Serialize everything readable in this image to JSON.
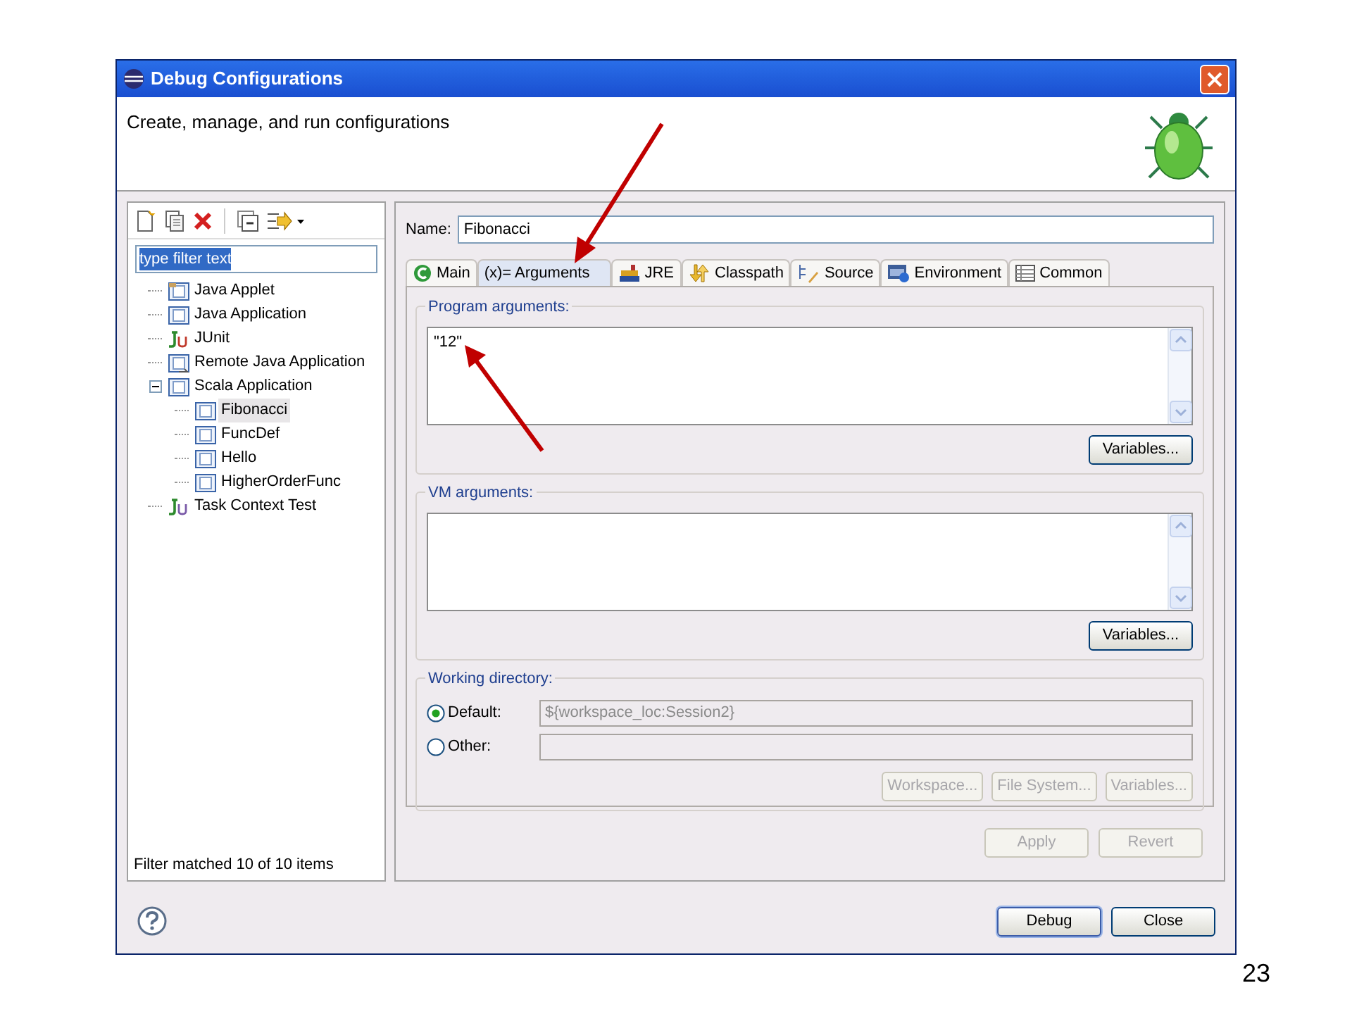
{
  "window": {
    "title": "Debug Configurations"
  },
  "header": {
    "text": "Create, manage, and run configurations"
  },
  "filter": {
    "value": "type filter text",
    "selected": true
  },
  "tree": [
    {
      "label": "Java Applet",
      "kind": "applet",
      "selected": false
    },
    {
      "label": "Java Application",
      "kind": "java",
      "selected": false
    },
    {
      "label": "JUnit",
      "kind": "junit",
      "selected": false
    },
    {
      "label": "Remote Java Application",
      "kind": "remote",
      "selected": false
    },
    {
      "label": "Scala Application",
      "kind": "scala",
      "selected": false,
      "expanded": true,
      "children": [
        {
          "label": "Fibonacci",
          "kind": "scala",
          "selected": true
        },
        {
          "label": "FuncDef",
          "kind": "scala",
          "selected": false
        },
        {
          "label": "Hello",
          "kind": "scala",
          "selected": false
        },
        {
          "label": "HigherOrderFunc",
          "kind": "scala",
          "selected": false
        }
      ]
    },
    {
      "label": "Task Context Test",
      "kind": "test",
      "selected": false
    }
  ],
  "filter_status": "Filter matched 10 of 10 items",
  "name": {
    "label": "Name:",
    "value": "Fibonacci"
  },
  "tabs": [
    {
      "label": "Main",
      "kind": "main",
      "selected": false
    },
    {
      "label": "(x)= Arguments",
      "kind": "arguments",
      "selected": true
    },
    {
      "label": "JRE",
      "kind": "jre",
      "selected": false
    },
    {
      "label": "Classpath",
      "kind": "classpath",
      "selected": false
    },
    {
      "label": "Source",
      "kind": "source",
      "selected": false
    },
    {
      "label": "Environment",
      "kind": "environment",
      "selected": false
    },
    {
      "label": "Common",
      "kind": "common",
      "selected": false
    }
  ],
  "program_arguments": {
    "label": "Program arguments:",
    "value": "\"12\"",
    "button": {
      "label": "Variables...",
      "disabled": false
    }
  },
  "vm_arguments": {
    "label": "VM arguments:",
    "button": {
      "label": "Variables...",
      "disabled": false
    }
  },
  "working_directory": {
    "label": "Working directory:",
    "options": [
      {
        "label": "Default:",
        "selected": true,
        "value": "${workspace_loc:Session2}"
      },
      {
        "label": "Other:",
        "selected": false
      }
    ],
    "buttons": [
      {
        "label": "Workspace...",
        "disabled": true
      },
      {
        "label": "File System...",
        "disabled": true
      },
      {
        "label": "Variables...",
        "disabled": true
      }
    ]
  },
  "actions": [
    {
      "label": "Apply",
      "disabled": true
    },
    {
      "label": "Revert",
      "disabled": true
    }
  ],
  "footer_buttons": [
    {
      "label": "Debug",
      "default": true
    },
    {
      "label": "Close",
      "default": false
    }
  ],
  "page_number": "23"
}
